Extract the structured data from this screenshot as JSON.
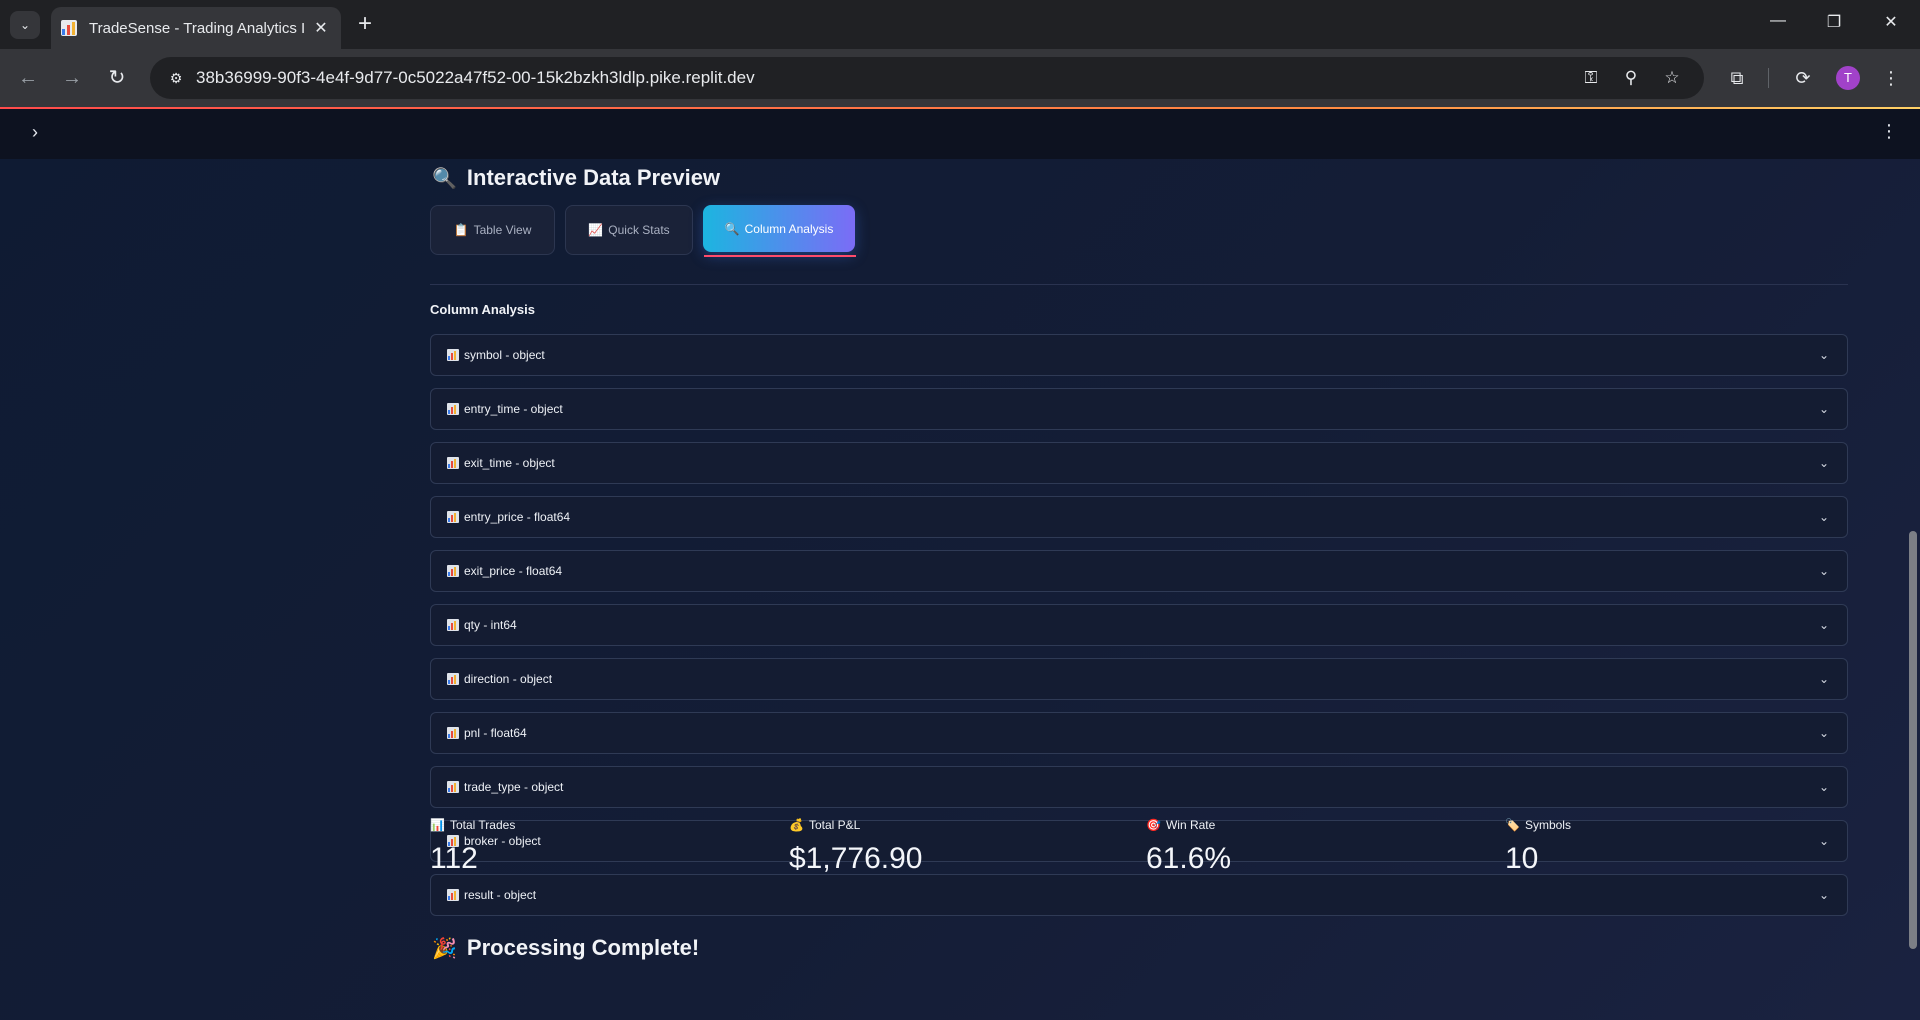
{
  "browser": {
    "tab_title": "TradeSense - Trading Analytics I",
    "url": "38b36999-90f3-4e4f-9d77-0c5022a47f52-00-15k2bzkh3ldlp.pike.replit.dev",
    "avatar_letter": "T"
  },
  "icons": {
    "tab_search": "⌄",
    "tab_close": "✕",
    "new_tab": "+",
    "minimize": "—",
    "restore": "❐",
    "close": "✕",
    "back": "←",
    "forward": "→",
    "reload": "↻",
    "site_info": "⚙",
    "key": "⚿",
    "zoom": "⚲",
    "star": "☆",
    "extensions": "⧉",
    "sync": "⟳",
    "menu": "⋮",
    "sidebar_toggle": "›",
    "app_menu": "⋮",
    "chevron": "⌄"
  },
  "page": {
    "section_title": "Interactive Data Preview",
    "section_emoji": "🔍",
    "tabs": [
      {
        "emoji": "📋",
        "label": "Table View"
      },
      {
        "emoji": "📈",
        "label": "Quick Stats"
      },
      {
        "emoji": "🔍",
        "label": "Column Analysis"
      }
    ],
    "active_tab": "Column Analysis",
    "sub_title": "Column Analysis",
    "columns": [
      "symbol - object",
      "entry_time - object",
      "exit_time - object",
      "entry_price - float64",
      "exit_price - float64",
      "qty - int64",
      "direction - object",
      "pnl - float64",
      "trade_type - object",
      "broker - object",
      "result - object"
    ],
    "complete_title": "Processing Complete!",
    "complete_emoji": "🎉",
    "metrics": [
      {
        "emoji": "📊",
        "label": "Total Trades",
        "value": "112"
      },
      {
        "emoji": "💰",
        "label": "Total P&L",
        "value": "$1,776.90"
      },
      {
        "emoji": "🎯",
        "label": "Win Rate",
        "value": "61.6%"
      },
      {
        "emoji": "🏷️",
        "label": "Symbols",
        "value": "10"
      }
    ]
  },
  "colors": {
    "accent_gradient_start": "#1cb5e0",
    "accent_gradient_end": "#7b6cf6",
    "active_underline": "#ff4b6b",
    "background": "#0f1729"
  }
}
